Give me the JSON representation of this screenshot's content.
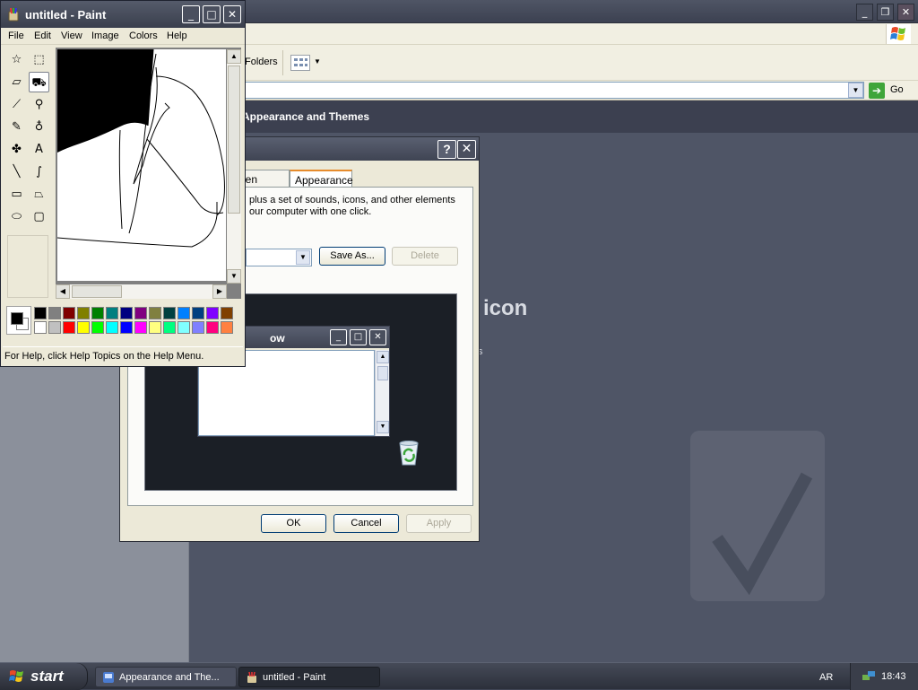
{
  "explorer": {
    "controls": {
      "minimize": "_",
      "maximize": "❐",
      "close": "✕"
    },
    "toolbar": {
      "folders_label": "Folders"
    },
    "address": {
      "go_label": "Go"
    },
    "header_title": "Appearance and Themes",
    "content": {
      "pick_icon_heading": "icon",
      "fragment": "s"
    }
  },
  "dialog": {
    "help": "?",
    "close": "✕",
    "tabs": [
      {
        "label": "Screen Saver"
      },
      {
        "label": "Appearance"
      }
    ],
    "description": "plus a set of sounds, icons, and other elements our computer with one click.",
    "buttons": {
      "save_as": "Save As...",
      "delete": "Delete",
      "ok": "OK",
      "cancel": "Cancel",
      "apply": "Apply"
    },
    "preview_window_title": "ow"
  },
  "paint": {
    "title": "untitled - Paint",
    "controls": {
      "minimize": "_",
      "maximize": "□",
      "close": "✕"
    },
    "menu": [
      "File",
      "Edit",
      "View",
      "Image",
      "Colors",
      "Help"
    ],
    "tools": [
      {
        "name": "free-form-select-icon",
        "glyph": "☆"
      },
      {
        "name": "rect-select-icon",
        "glyph": "⬚"
      },
      {
        "name": "eraser-icon",
        "glyph": "▱"
      },
      {
        "name": "fill-icon",
        "glyph": "⛟"
      },
      {
        "name": "color-picker-icon",
        "glyph": "⟋"
      },
      {
        "name": "magnifier-icon",
        "glyph": "⚲"
      },
      {
        "name": "pencil-icon",
        "glyph": "✎"
      },
      {
        "name": "brush-icon",
        "glyph": "♁"
      },
      {
        "name": "airbrush-icon",
        "glyph": "✤"
      },
      {
        "name": "text-icon",
        "glyph": "A"
      },
      {
        "name": "line-icon",
        "glyph": "╲"
      },
      {
        "name": "curve-icon",
        "glyph": "∫"
      },
      {
        "name": "rectangle-icon",
        "glyph": "▭"
      },
      {
        "name": "polygon-icon",
        "glyph": "⏢"
      },
      {
        "name": "ellipse-icon",
        "glyph": "⬭"
      },
      {
        "name": "rounded-rect-icon",
        "glyph": "▢"
      }
    ],
    "palette_top": [
      "#000000",
      "#808080",
      "#800000",
      "#808000",
      "#008000",
      "#008080",
      "#000080",
      "#800080",
      "#808040",
      "#004040",
      "#0080ff",
      "#004080",
      "#8000ff",
      "#804000"
    ],
    "palette_bottom": [
      "#ffffff",
      "#c0c0c0",
      "#ff0000",
      "#ffff00",
      "#00ff00",
      "#00ffff",
      "#0000ff",
      "#ff00ff",
      "#ffff80",
      "#00ff80",
      "#80ffff",
      "#8080ff",
      "#ff0080",
      "#ff8040"
    ],
    "status": "For Help, click Help Topics on the Help Menu."
  },
  "taskbar": {
    "start_label": "start",
    "tasks": [
      {
        "label": "Appearance and The..."
      },
      {
        "label": "untitled - Paint"
      }
    ],
    "language": "AR",
    "clock": "18:43"
  }
}
